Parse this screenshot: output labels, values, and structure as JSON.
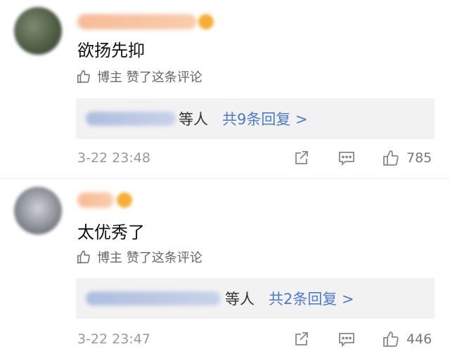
{
  "comments": [
    {
      "text": "欲扬先抑",
      "liked_by": "博主 赞了这条评论",
      "reply_suffix": "等人",
      "reply_link": "共9条回复 >",
      "time": "3-22 23:48",
      "likes": "785"
    },
    {
      "text": "太优秀了",
      "liked_by": "博主 赞了这条评论",
      "reply_suffix": "等人",
      "reply_link": "共2条回复 >",
      "time": "3-22 23:47",
      "likes": "446"
    }
  ],
  "icons": {
    "liked_by": "thumbs-up-outline-icon",
    "share": "share-icon",
    "comment": "comment-bubble-icon",
    "like": "thumbs-up-icon"
  },
  "colors": {
    "link": "#4b7bd0",
    "reply_bg": "#f2f2f2",
    "muted": "#999999"
  }
}
